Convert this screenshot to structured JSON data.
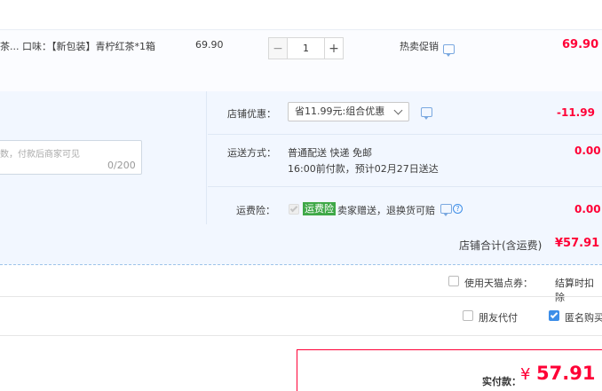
{
  "item": {
    "name": "茶... 口味：【新包装】青柠红茶*1箱",
    "unit_price": "69.90",
    "quantity": "1",
    "minus": "−",
    "plus": "+",
    "promo_label": "热卖促销",
    "subtotal": "69.90"
  },
  "message": {
    "placeholder": "数，付款后商家可见",
    "counter": "0/200"
  },
  "shop_discount": {
    "label": "店铺优惠：",
    "selected": "省11.99元:组合优惠",
    "amount": "-11.99"
  },
  "shipping": {
    "label": "运送方式：",
    "line1": "普通配送 快递 免邮",
    "line2": "16:00前付款，预计02月27日送达",
    "amount": "0.00"
  },
  "insurance": {
    "label": "运费险：",
    "badge": "运费险",
    "text": "卖家赠送，退换货可赔",
    "question": "?",
    "amount": "0.00"
  },
  "shop_total": {
    "label": "店铺合计(含运费)",
    "amount": "¥57.91"
  },
  "coupon": {
    "label": "使用天猫点券：",
    "note": "结算时扣除"
  },
  "options": {
    "friend_pay": "朋友代付",
    "anonymous": "匿名购买"
  },
  "payment": {
    "label": "实付款：",
    "currency": "¥",
    "amount": "57.91"
  },
  "colors": {
    "price_red": "#ff0036",
    "accent_blue": "#3d8ee8",
    "panel_bg": "#f2f7ff",
    "insurance_green": "#3fa847"
  }
}
